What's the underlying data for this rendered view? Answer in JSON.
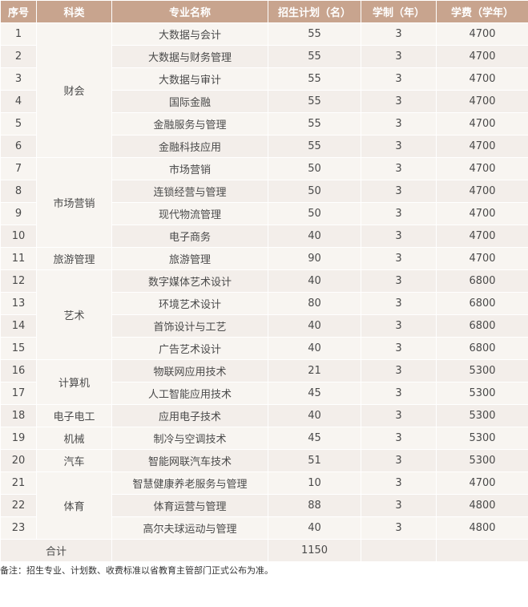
{
  "table": {
    "headers": [
      "序号",
      "科类",
      "专业名称",
      "招生计划（名）",
      "学制（年）",
      "学费（学年）"
    ],
    "rows": [
      {
        "no": "1",
        "category": "财会",
        "cat_span": 6,
        "major": "大数据与会计",
        "plan": "55",
        "years": "3",
        "fee": "4700"
      },
      {
        "no": "2",
        "category": "",
        "cat_span": 0,
        "major": "大数据与财务管理",
        "plan": "55",
        "years": "3",
        "fee": "4700"
      },
      {
        "no": "3",
        "category": "",
        "cat_span": 0,
        "major": "大数据与审计",
        "plan": "55",
        "years": "3",
        "fee": "4700"
      },
      {
        "no": "4",
        "category": "",
        "cat_span": 0,
        "major": "国际金融",
        "plan": "55",
        "years": "3",
        "fee": "4700"
      },
      {
        "no": "5",
        "category": "",
        "cat_span": 0,
        "major": "金融服务与管理",
        "plan": "55",
        "years": "3",
        "fee": "4700"
      },
      {
        "no": "6",
        "category": "",
        "cat_span": 0,
        "major": "金融科技应用",
        "plan": "55",
        "years": "3",
        "fee": "4700"
      },
      {
        "no": "7",
        "category": "市场营销",
        "cat_span": 4,
        "major": "市场营销",
        "plan": "50",
        "years": "3",
        "fee": "4700"
      },
      {
        "no": "8",
        "category": "",
        "cat_span": 0,
        "major": "连锁经营与管理",
        "plan": "50",
        "years": "3",
        "fee": "4700"
      },
      {
        "no": "9",
        "category": "",
        "cat_span": 0,
        "major": "现代物流管理",
        "plan": "50",
        "years": "3",
        "fee": "4700"
      },
      {
        "no": "10",
        "category": "",
        "cat_span": 0,
        "major": "电子商务",
        "plan": "40",
        "years": "3",
        "fee": "4700"
      },
      {
        "no": "11",
        "category": "旅游管理",
        "cat_span": 1,
        "major": "旅游管理",
        "plan": "90",
        "years": "3",
        "fee": "4700"
      },
      {
        "no": "12",
        "category": "艺术",
        "cat_span": 4,
        "major": "数字媒体艺术设计",
        "plan": "40",
        "years": "3",
        "fee": "6800"
      },
      {
        "no": "13",
        "category": "",
        "cat_span": 0,
        "major": "环境艺术设计",
        "plan": "80",
        "years": "3",
        "fee": "6800"
      },
      {
        "no": "14",
        "category": "",
        "cat_span": 0,
        "major": "首饰设计与工艺",
        "plan": "40",
        "years": "3",
        "fee": "6800"
      },
      {
        "no": "15",
        "category": "",
        "cat_span": 0,
        "major": "广告艺术设计",
        "plan": "40",
        "years": "3",
        "fee": "6800"
      },
      {
        "no": "16",
        "category": "计算机",
        "cat_span": 2,
        "major": "物联网应用技术",
        "plan": "21",
        "years": "3",
        "fee": "5300"
      },
      {
        "no": "17",
        "category": "",
        "cat_span": 0,
        "major": "人工智能应用技术",
        "plan": "45",
        "years": "3",
        "fee": "5300"
      },
      {
        "no": "18",
        "category": "电子电工",
        "cat_span": 1,
        "major": "应用电子技术",
        "plan": "40",
        "years": "3",
        "fee": "5300"
      },
      {
        "no": "19",
        "category": "机械",
        "cat_span": 1,
        "major": "制冷与空调技术",
        "plan": "45",
        "years": "3",
        "fee": "5300"
      },
      {
        "no": "20",
        "category": "汽车",
        "cat_span": 1,
        "major": "智能网联汽车技术",
        "plan": "51",
        "years": "3",
        "fee": "5300"
      },
      {
        "no": "21",
        "category": "体育",
        "cat_span": 3,
        "major": "智慧健康养老服务与管理",
        "plan": "10",
        "years": "3",
        "fee": "4700"
      },
      {
        "no": "22",
        "category": "",
        "cat_span": 0,
        "major": "体育运营与管理",
        "plan": "88",
        "years": "3",
        "fee": "4800"
      },
      {
        "no": "23",
        "category": "",
        "cat_span": 0,
        "major": "高尔夫球运动与管理",
        "plan": "40",
        "years": "3",
        "fee": "4800"
      }
    ],
    "total": {
      "label": "合计",
      "plan": "1150"
    }
  },
  "note": "备注：招生专业、计划数、收费标准以省教育主管部门正式公布为准。"
}
